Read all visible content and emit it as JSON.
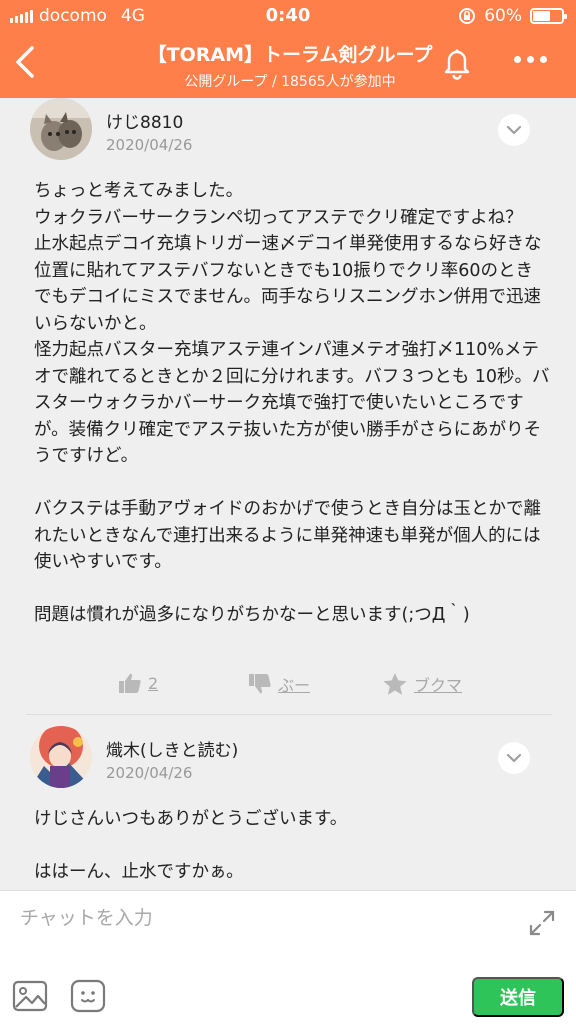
{
  "status_bar": {
    "carrier": "docomo",
    "network": "4G",
    "time": "0:40",
    "battery": "60%",
    "battery_level": 0.6
  },
  "header": {
    "title": "【TORAM】トーラム剣グループ",
    "subtitle": "公開グループ / 18565人が参加中",
    "accent_color": "#ff7f4a"
  },
  "posts": [
    {
      "author": "けじ8810",
      "date": "2020/04/26",
      "paragraphs": [
        "ちょっと考えてみました。\nウォクラバーサークランペ切ってアステでクリ確定ですよね？\n止水起点デコイ充填トリガー速〆デコイ単発使用するなら好きな位置に貼れてアステバフないときでも10振りでクリ率60のときでもデコイにミスでません。両手ならリスニングホン併用で迅速いらないかと。\n怪力起点バスター充填アステ連インパ連メテオ強打〆110%メテオで離れてるときとか２回に分けれます。バフ３つとも 10秒。バスターウォクラかバーサーク充填で強打で使いたいところですが。装備クリ確定でアステ抜いた方が使い勝手がさらにあがりそうですけど。",
        "バクステは手動アヴォイドのおかげで使うとき自分は玉とかで離れたいときなんで連打出来るように単発神速も単発が個人的には使いやすいです。",
        "問題は慣れが過多になりがちかなーと思います(;つД｀)"
      ],
      "actions": {
        "like_count": "2",
        "boo_label": "ぶー",
        "bookmark_label": "ブクマ"
      }
    },
    {
      "author": "熾木(しきと読む)",
      "date": "2020/04/26",
      "paragraphs": [
        "けじさんいつもありがとうございます。",
        "ははーん、止水ですかぁ。"
      ]
    }
  ],
  "input_bar": {
    "placeholder": "チャットを入力",
    "send_label": "送信",
    "send_color": "#2ec45a"
  }
}
